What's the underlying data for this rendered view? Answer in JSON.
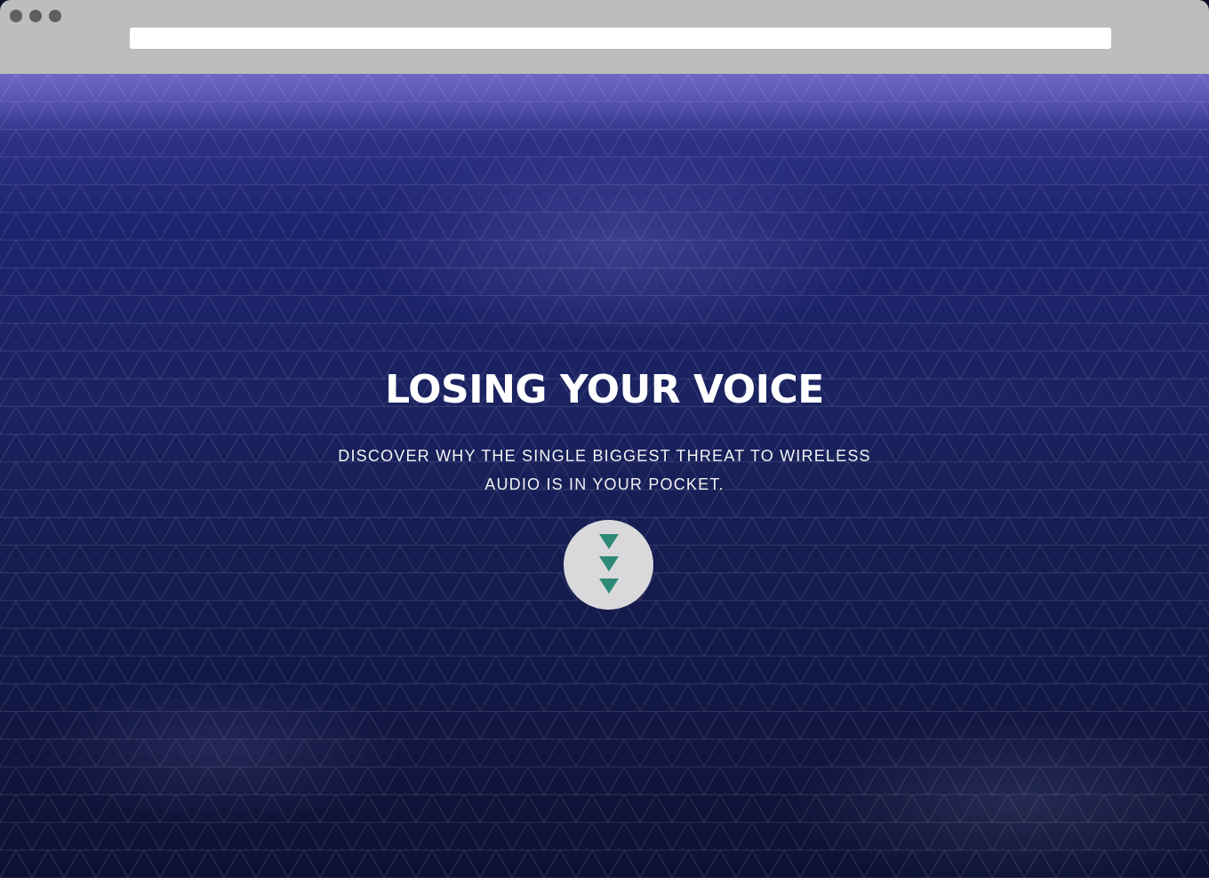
{
  "browser": {
    "window_controls": [
      "close-dot",
      "minimize-dot",
      "maximize-dot"
    ],
    "address_bar": {
      "value": "",
      "placeholder": ""
    }
  },
  "hero": {
    "title": "LOSING YOUR VOICE",
    "subtitle": "DISCOVER WHY THE SINGLE BIGGEST THREAT TO WIRELESS AUDIO IS IN YOUR POCKET.",
    "scroll_icon": "triple-chevron-down-icon",
    "colors": {
      "overlay": "#1d2470",
      "accent": "#2e8a76",
      "button_bg": "#d9d9db",
      "text": "#ffffff"
    }
  }
}
